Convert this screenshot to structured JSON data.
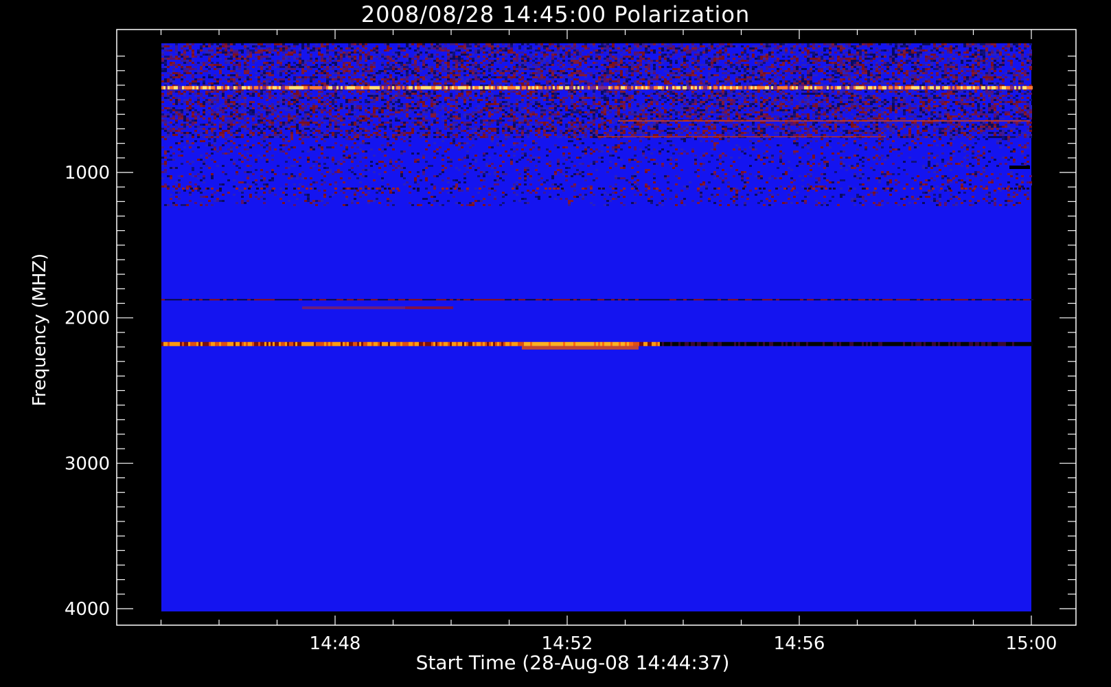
{
  "chart_data": {
    "type": "heatmap",
    "title": "2008/08/28 14:45:00 Polarization",
    "xlabel": "Start Time (28-Aug-08 14:44:37)",
    "ylabel": "Frequency (MHZ)",
    "x_ticks": [
      {
        "label": "14:48",
        "minutes": 48
      },
      {
        "label": "14:52",
        "minutes": 52
      },
      {
        "label": "14:56",
        "minutes": 56
      },
      {
        "label": "15:00",
        "minutes": 60
      }
    ],
    "y_ticks": [
      {
        "label": "1000",
        "mhz": 1000
      },
      {
        "label": "2000",
        "mhz": 2000
      },
      {
        "label": "3000",
        "mhz": 3000
      },
      {
        "label": "4000",
        "mhz": 4000
      }
    ],
    "y_inverted": true,
    "data_extent": {
      "time_start": "14:44:37",
      "time_end": "15:00:00",
      "freq_min_mhz": 100,
      "freq_max_mhz": 4000
    },
    "background_color": "#1414f0",
    "features": [
      {
        "freq_mhz": 420,
        "kind": "bright band",
        "color": "#ffd060"
      },
      {
        "freq_mhz": 2180,
        "kind": "strong emission band",
        "color": "#ff8a00"
      },
      {
        "freq_mhz": 1880,
        "kind": "dark/red line",
        "color": "#8a1010"
      }
    ]
  }
}
